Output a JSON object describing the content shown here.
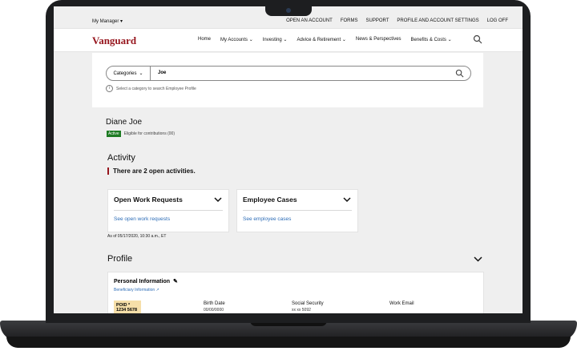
{
  "header": {
    "manager_label": "My Manager",
    "utility_links": [
      "OPEN AN ACCOUNT",
      "FORMS",
      "SUPPORT",
      "PROFILE AND ACCOUNT SETTINGS",
      "LOG OFF"
    ]
  },
  "nav": {
    "logo": "Vanguard",
    "items": [
      {
        "label": "Home",
        "chevron": false
      },
      {
        "label": "My Accounts",
        "chevron": true
      },
      {
        "label": "Investing",
        "chevron": true
      },
      {
        "label": "Advice & Retirement",
        "chevron": true
      },
      {
        "label": "News & Perspectives",
        "chevron": false
      },
      {
        "label": "Benefits & Costs",
        "chevron": true
      }
    ]
  },
  "search": {
    "category_label": "Categories",
    "query": "Joe",
    "hint": "Select a category to search Employee Profile"
  },
  "employee": {
    "name": "Diane Joe",
    "status": "Active",
    "eligibility": "Eligible for contributions (00)"
  },
  "activity": {
    "heading": "Activity",
    "summary": "There are 2 open activities.",
    "cards": [
      {
        "title": "Open Work Requests",
        "link": "See open work requests"
      },
      {
        "title": "Employee Cases",
        "link": "See employee cases"
      }
    ],
    "as_of": "As of 05/17/2020, 10:30 a.m., ET"
  },
  "profile": {
    "heading": "Profile",
    "personal_title": "Personal Information",
    "beneficiary_link": "Beneficiary Information",
    "poid_label": "POID *",
    "poid_value": "1234 5678",
    "fields": [
      {
        "label": "Birth Date",
        "value": "00/00/0000"
      },
      {
        "label": "Social Security",
        "value": "xx xx 5092"
      },
      {
        "label": "Work Email",
        "value": ""
      }
    ]
  },
  "colors": {
    "brand": "#96151d",
    "link": "#2d6db7",
    "active": "#1d7b23",
    "poid_bg": "#f6dfa9"
  }
}
